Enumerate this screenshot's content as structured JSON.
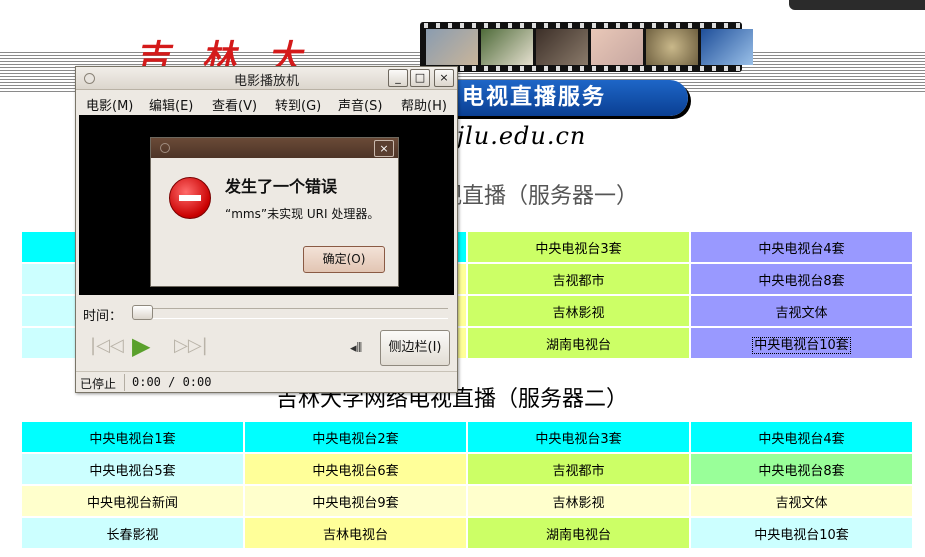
{
  "page": {
    "logo_text": "吉林大学",
    "banner": "电视直播服务",
    "url_fragment": ".jlu.edu.cn",
    "section1_title_fragment": "视直播（服务器一）",
    "section2_title": "吉林大学网络电视直播（服务器二）",
    "section1_visible": [
      [
        "中央电视台3套",
        "中央电视台4套"
      ],
      [
        "吉视都市",
        "中央电视台8套"
      ],
      [
        "吉林影视",
        "吉视文体"
      ],
      [
        "湖南电视台",
        "中央电视台10套"
      ]
    ],
    "section2": [
      [
        "中央电视台1套",
        "中央电视台2套",
        "中央电视台3套",
        "中央电视台4套"
      ],
      [
        "中央电视台5套",
        "中央电视台6套",
        "吉视都市",
        "中央电视台8套"
      ],
      [
        "中央电视台新闻",
        "中央电视台9套",
        "吉林影视",
        "吉视文体"
      ],
      [
        "长春影视",
        "吉林电视台",
        "湖南电视台",
        "中央电视台10套"
      ]
    ],
    "colors": {
      "aqua": "#00ffff",
      "light_cyan": "#ccffff",
      "light_yellow": "#ffff99",
      "cream": "#ffffcc",
      "lime": "#ccff66",
      "purple": "#9999ff",
      "green": "#99ff99",
      "banner_blue": "#0a3f93"
    }
  },
  "player": {
    "title": "电影播放机",
    "window_buttons": [
      "_",
      "□",
      "×"
    ],
    "menu": [
      "电影(M)",
      "编辑(E)",
      "查看(V)",
      "转到(G)",
      "声音(S)",
      "帮助(H)"
    ],
    "time_label": "时间：",
    "controls": {
      "prev_icon": "skip-back-icon",
      "play_icon": "play-icon",
      "next_icon": "skip-forward-icon",
      "volume_icon": "volume-icon"
    },
    "sidebar_button": "侧边栏(I)",
    "status": "已停止",
    "time_display": "0:00 / 0:00"
  },
  "dialog": {
    "close_glyph": "×",
    "heading": "发生了一个错误",
    "message": "“mms”未实现 URI 处理器。",
    "ok_label": "确定(O)",
    "icon": "error-icon"
  }
}
